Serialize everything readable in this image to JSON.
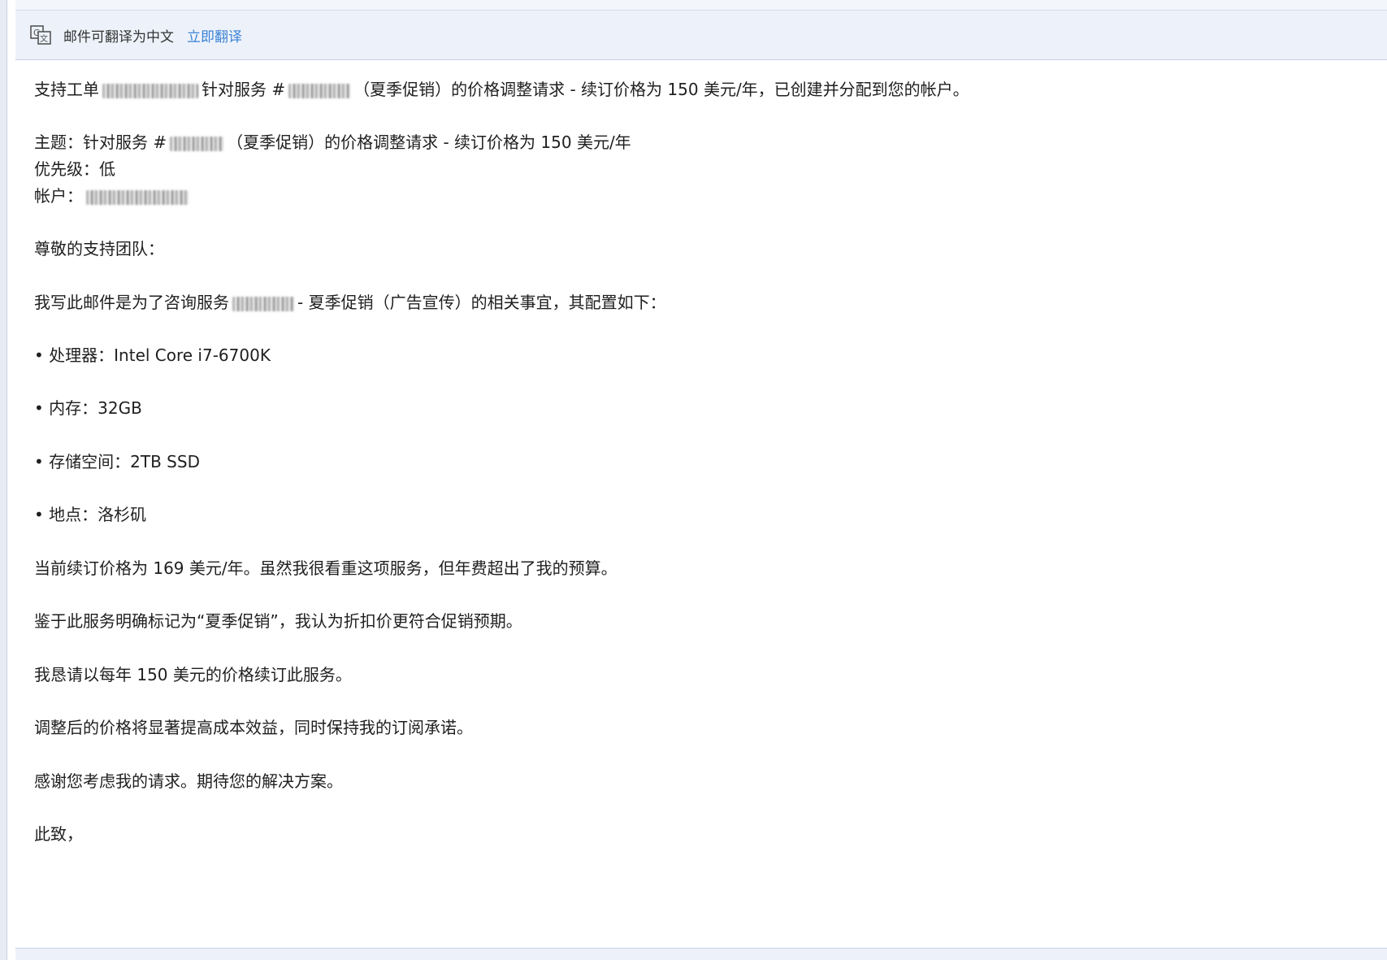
{
  "translate_bar": {
    "icon": "translate-icon",
    "prompt": "邮件可翻译为中文",
    "action": "立即翻译"
  },
  "email": {
    "line1_a": "支持工单",
    "line1_b": "针对服务 #",
    "line1_c": "（夏季促销）的价格调整请求 - 续订价格为 150 美元/年，已创建并分配到您的帐户。",
    "subject_a": "主题：针对服务 #",
    "subject_b": "（夏季促销）的价格调整请求 - 续订价格为 150 美元/年",
    "priority": "优先级：低",
    "account": "帐户：",
    "greeting": "尊敬的支持团队：",
    "intro_a": "我写此邮件是为了咨询服务",
    "intro_b": "- 夏季促销（广告宣传）的相关事宜，其配置如下：",
    "bullets": [
      "• 处理器：Intel Core i7-6700K",
      "• 内存：32GB",
      "• 存储空间：2TB SSD",
      "• 地点：洛杉矶"
    ],
    "para1": "当前续订价格为 169 美元/年。虽然我很看重这项服务，但年费超出了我的预算。",
    "para2": "鉴于此服务明确标记为“夏季促销”，我认为折扣价更符合促销预期。",
    "para3": "我恳请以每年 150 美元的价格续订此服务。",
    "para4": "调整后的价格将显著提高成本效益，同时保持我的订阅承诺。",
    "para5": "感谢您考虑我的请求。期待您的解决方案。",
    "closing": "此致，"
  },
  "colors": {
    "link": "#3b82d6",
    "bar_bg": "#edf2fa"
  }
}
